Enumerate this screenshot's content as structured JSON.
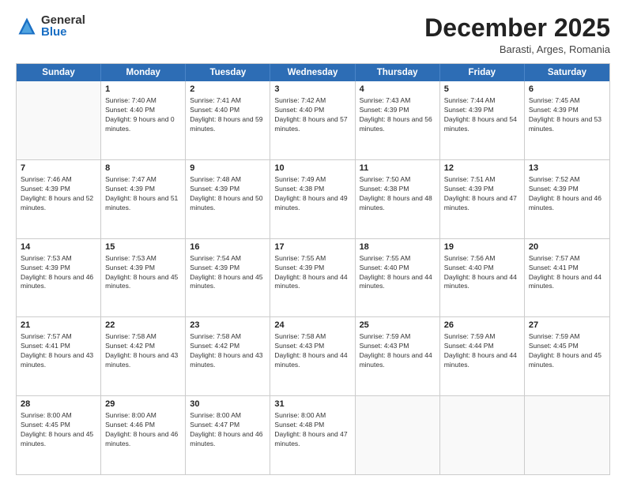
{
  "logo": {
    "general": "General",
    "blue": "Blue"
  },
  "title": "December 2025",
  "subtitle": "Barasti, Arges, Romania",
  "header_days": [
    "Sunday",
    "Monday",
    "Tuesday",
    "Wednesday",
    "Thursday",
    "Friday",
    "Saturday"
  ],
  "rows": [
    [
      {
        "day": "",
        "empty": true
      },
      {
        "day": "1",
        "sunrise": "Sunrise: 7:40 AM",
        "sunset": "Sunset: 4:40 PM",
        "daylight": "Daylight: 9 hours and 0 minutes."
      },
      {
        "day": "2",
        "sunrise": "Sunrise: 7:41 AM",
        "sunset": "Sunset: 4:40 PM",
        "daylight": "Daylight: 8 hours and 59 minutes."
      },
      {
        "day": "3",
        "sunrise": "Sunrise: 7:42 AM",
        "sunset": "Sunset: 4:40 PM",
        "daylight": "Daylight: 8 hours and 57 minutes."
      },
      {
        "day": "4",
        "sunrise": "Sunrise: 7:43 AM",
        "sunset": "Sunset: 4:39 PM",
        "daylight": "Daylight: 8 hours and 56 minutes."
      },
      {
        "day": "5",
        "sunrise": "Sunrise: 7:44 AM",
        "sunset": "Sunset: 4:39 PM",
        "daylight": "Daylight: 8 hours and 54 minutes."
      },
      {
        "day": "6",
        "sunrise": "Sunrise: 7:45 AM",
        "sunset": "Sunset: 4:39 PM",
        "daylight": "Daylight: 8 hours and 53 minutes."
      }
    ],
    [
      {
        "day": "7",
        "sunrise": "Sunrise: 7:46 AM",
        "sunset": "Sunset: 4:39 PM",
        "daylight": "Daylight: 8 hours and 52 minutes."
      },
      {
        "day": "8",
        "sunrise": "Sunrise: 7:47 AM",
        "sunset": "Sunset: 4:39 PM",
        "daylight": "Daylight: 8 hours and 51 minutes."
      },
      {
        "day": "9",
        "sunrise": "Sunrise: 7:48 AM",
        "sunset": "Sunset: 4:39 PM",
        "daylight": "Daylight: 8 hours and 50 minutes."
      },
      {
        "day": "10",
        "sunrise": "Sunrise: 7:49 AM",
        "sunset": "Sunset: 4:38 PM",
        "daylight": "Daylight: 8 hours and 49 minutes."
      },
      {
        "day": "11",
        "sunrise": "Sunrise: 7:50 AM",
        "sunset": "Sunset: 4:38 PM",
        "daylight": "Daylight: 8 hours and 48 minutes."
      },
      {
        "day": "12",
        "sunrise": "Sunrise: 7:51 AM",
        "sunset": "Sunset: 4:39 PM",
        "daylight": "Daylight: 8 hours and 47 minutes."
      },
      {
        "day": "13",
        "sunrise": "Sunrise: 7:52 AM",
        "sunset": "Sunset: 4:39 PM",
        "daylight": "Daylight: 8 hours and 46 minutes."
      }
    ],
    [
      {
        "day": "14",
        "sunrise": "Sunrise: 7:53 AM",
        "sunset": "Sunset: 4:39 PM",
        "daylight": "Daylight: 8 hours and 46 minutes."
      },
      {
        "day": "15",
        "sunrise": "Sunrise: 7:53 AM",
        "sunset": "Sunset: 4:39 PM",
        "daylight": "Daylight: 8 hours and 45 minutes."
      },
      {
        "day": "16",
        "sunrise": "Sunrise: 7:54 AM",
        "sunset": "Sunset: 4:39 PM",
        "daylight": "Daylight: 8 hours and 45 minutes."
      },
      {
        "day": "17",
        "sunrise": "Sunrise: 7:55 AM",
        "sunset": "Sunset: 4:39 PM",
        "daylight": "Daylight: 8 hours and 44 minutes."
      },
      {
        "day": "18",
        "sunrise": "Sunrise: 7:55 AM",
        "sunset": "Sunset: 4:40 PM",
        "daylight": "Daylight: 8 hours and 44 minutes."
      },
      {
        "day": "19",
        "sunrise": "Sunrise: 7:56 AM",
        "sunset": "Sunset: 4:40 PM",
        "daylight": "Daylight: 8 hours and 44 minutes."
      },
      {
        "day": "20",
        "sunrise": "Sunrise: 7:57 AM",
        "sunset": "Sunset: 4:41 PM",
        "daylight": "Daylight: 8 hours and 44 minutes."
      }
    ],
    [
      {
        "day": "21",
        "sunrise": "Sunrise: 7:57 AM",
        "sunset": "Sunset: 4:41 PM",
        "daylight": "Daylight: 8 hours and 43 minutes."
      },
      {
        "day": "22",
        "sunrise": "Sunrise: 7:58 AM",
        "sunset": "Sunset: 4:42 PM",
        "daylight": "Daylight: 8 hours and 43 minutes."
      },
      {
        "day": "23",
        "sunrise": "Sunrise: 7:58 AM",
        "sunset": "Sunset: 4:42 PM",
        "daylight": "Daylight: 8 hours and 43 minutes."
      },
      {
        "day": "24",
        "sunrise": "Sunrise: 7:58 AM",
        "sunset": "Sunset: 4:43 PM",
        "daylight": "Daylight: 8 hours and 44 minutes."
      },
      {
        "day": "25",
        "sunrise": "Sunrise: 7:59 AM",
        "sunset": "Sunset: 4:43 PM",
        "daylight": "Daylight: 8 hours and 44 minutes."
      },
      {
        "day": "26",
        "sunrise": "Sunrise: 7:59 AM",
        "sunset": "Sunset: 4:44 PM",
        "daylight": "Daylight: 8 hours and 44 minutes."
      },
      {
        "day": "27",
        "sunrise": "Sunrise: 7:59 AM",
        "sunset": "Sunset: 4:45 PM",
        "daylight": "Daylight: 8 hours and 45 minutes."
      }
    ],
    [
      {
        "day": "28",
        "sunrise": "Sunrise: 8:00 AM",
        "sunset": "Sunset: 4:45 PM",
        "daylight": "Daylight: 8 hours and 45 minutes."
      },
      {
        "day": "29",
        "sunrise": "Sunrise: 8:00 AM",
        "sunset": "Sunset: 4:46 PM",
        "daylight": "Daylight: 8 hours and 46 minutes."
      },
      {
        "day": "30",
        "sunrise": "Sunrise: 8:00 AM",
        "sunset": "Sunset: 4:47 PM",
        "daylight": "Daylight: 8 hours and 46 minutes."
      },
      {
        "day": "31",
        "sunrise": "Sunrise: 8:00 AM",
        "sunset": "Sunset: 4:48 PM",
        "daylight": "Daylight: 8 hours and 47 minutes."
      },
      {
        "day": "",
        "empty": true
      },
      {
        "day": "",
        "empty": true
      },
      {
        "day": "",
        "empty": true
      }
    ]
  ]
}
